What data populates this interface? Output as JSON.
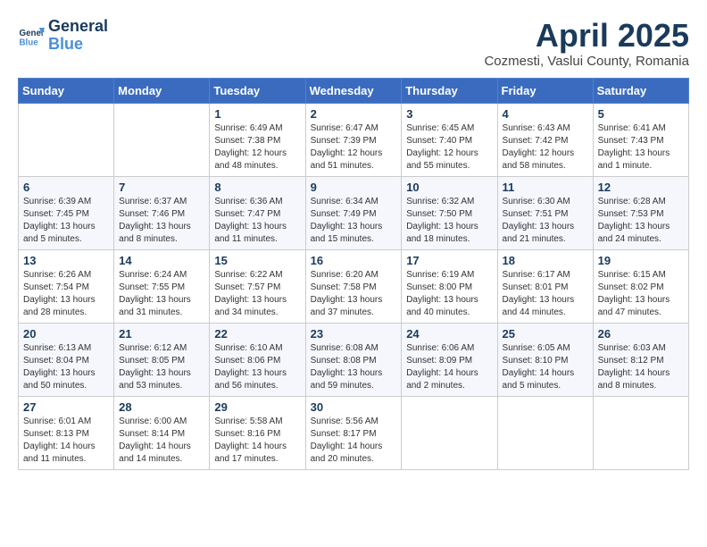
{
  "header": {
    "logo_line1": "General",
    "logo_line2": "Blue",
    "month": "April 2025",
    "location": "Cozmesti, Vaslui County, Romania"
  },
  "weekdays": [
    "Sunday",
    "Monday",
    "Tuesday",
    "Wednesday",
    "Thursday",
    "Friday",
    "Saturday"
  ],
  "weeks": [
    [
      {
        "day": "",
        "content": ""
      },
      {
        "day": "",
        "content": ""
      },
      {
        "day": "1",
        "content": "Sunrise: 6:49 AM\nSunset: 7:38 PM\nDaylight: 12 hours\nand 48 minutes."
      },
      {
        "day": "2",
        "content": "Sunrise: 6:47 AM\nSunset: 7:39 PM\nDaylight: 12 hours\nand 51 minutes."
      },
      {
        "day": "3",
        "content": "Sunrise: 6:45 AM\nSunset: 7:40 PM\nDaylight: 12 hours\nand 55 minutes."
      },
      {
        "day": "4",
        "content": "Sunrise: 6:43 AM\nSunset: 7:42 PM\nDaylight: 12 hours\nand 58 minutes."
      },
      {
        "day": "5",
        "content": "Sunrise: 6:41 AM\nSunset: 7:43 PM\nDaylight: 13 hours\nand 1 minute."
      }
    ],
    [
      {
        "day": "6",
        "content": "Sunrise: 6:39 AM\nSunset: 7:45 PM\nDaylight: 13 hours\nand 5 minutes."
      },
      {
        "day": "7",
        "content": "Sunrise: 6:37 AM\nSunset: 7:46 PM\nDaylight: 13 hours\nand 8 minutes."
      },
      {
        "day": "8",
        "content": "Sunrise: 6:36 AM\nSunset: 7:47 PM\nDaylight: 13 hours\nand 11 minutes."
      },
      {
        "day": "9",
        "content": "Sunrise: 6:34 AM\nSunset: 7:49 PM\nDaylight: 13 hours\nand 15 minutes."
      },
      {
        "day": "10",
        "content": "Sunrise: 6:32 AM\nSunset: 7:50 PM\nDaylight: 13 hours\nand 18 minutes."
      },
      {
        "day": "11",
        "content": "Sunrise: 6:30 AM\nSunset: 7:51 PM\nDaylight: 13 hours\nand 21 minutes."
      },
      {
        "day": "12",
        "content": "Sunrise: 6:28 AM\nSunset: 7:53 PM\nDaylight: 13 hours\nand 24 minutes."
      }
    ],
    [
      {
        "day": "13",
        "content": "Sunrise: 6:26 AM\nSunset: 7:54 PM\nDaylight: 13 hours\nand 28 minutes."
      },
      {
        "day": "14",
        "content": "Sunrise: 6:24 AM\nSunset: 7:55 PM\nDaylight: 13 hours\nand 31 minutes."
      },
      {
        "day": "15",
        "content": "Sunrise: 6:22 AM\nSunset: 7:57 PM\nDaylight: 13 hours\nand 34 minutes."
      },
      {
        "day": "16",
        "content": "Sunrise: 6:20 AM\nSunset: 7:58 PM\nDaylight: 13 hours\nand 37 minutes."
      },
      {
        "day": "17",
        "content": "Sunrise: 6:19 AM\nSunset: 8:00 PM\nDaylight: 13 hours\nand 40 minutes."
      },
      {
        "day": "18",
        "content": "Sunrise: 6:17 AM\nSunset: 8:01 PM\nDaylight: 13 hours\nand 44 minutes."
      },
      {
        "day": "19",
        "content": "Sunrise: 6:15 AM\nSunset: 8:02 PM\nDaylight: 13 hours\nand 47 minutes."
      }
    ],
    [
      {
        "day": "20",
        "content": "Sunrise: 6:13 AM\nSunset: 8:04 PM\nDaylight: 13 hours\nand 50 minutes."
      },
      {
        "day": "21",
        "content": "Sunrise: 6:12 AM\nSunset: 8:05 PM\nDaylight: 13 hours\nand 53 minutes."
      },
      {
        "day": "22",
        "content": "Sunrise: 6:10 AM\nSunset: 8:06 PM\nDaylight: 13 hours\nand 56 minutes."
      },
      {
        "day": "23",
        "content": "Sunrise: 6:08 AM\nSunset: 8:08 PM\nDaylight: 13 hours\nand 59 minutes."
      },
      {
        "day": "24",
        "content": "Sunrise: 6:06 AM\nSunset: 8:09 PM\nDaylight: 14 hours\nand 2 minutes."
      },
      {
        "day": "25",
        "content": "Sunrise: 6:05 AM\nSunset: 8:10 PM\nDaylight: 14 hours\nand 5 minutes."
      },
      {
        "day": "26",
        "content": "Sunrise: 6:03 AM\nSunset: 8:12 PM\nDaylight: 14 hours\nand 8 minutes."
      }
    ],
    [
      {
        "day": "27",
        "content": "Sunrise: 6:01 AM\nSunset: 8:13 PM\nDaylight: 14 hours\nand 11 minutes."
      },
      {
        "day": "28",
        "content": "Sunrise: 6:00 AM\nSunset: 8:14 PM\nDaylight: 14 hours\nand 14 minutes."
      },
      {
        "day": "29",
        "content": "Sunrise: 5:58 AM\nSunset: 8:16 PM\nDaylight: 14 hours\nand 17 minutes."
      },
      {
        "day": "30",
        "content": "Sunrise: 5:56 AM\nSunset: 8:17 PM\nDaylight: 14 hours\nand 20 minutes."
      },
      {
        "day": "",
        "content": ""
      },
      {
        "day": "",
        "content": ""
      },
      {
        "day": "",
        "content": ""
      }
    ]
  ]
}
